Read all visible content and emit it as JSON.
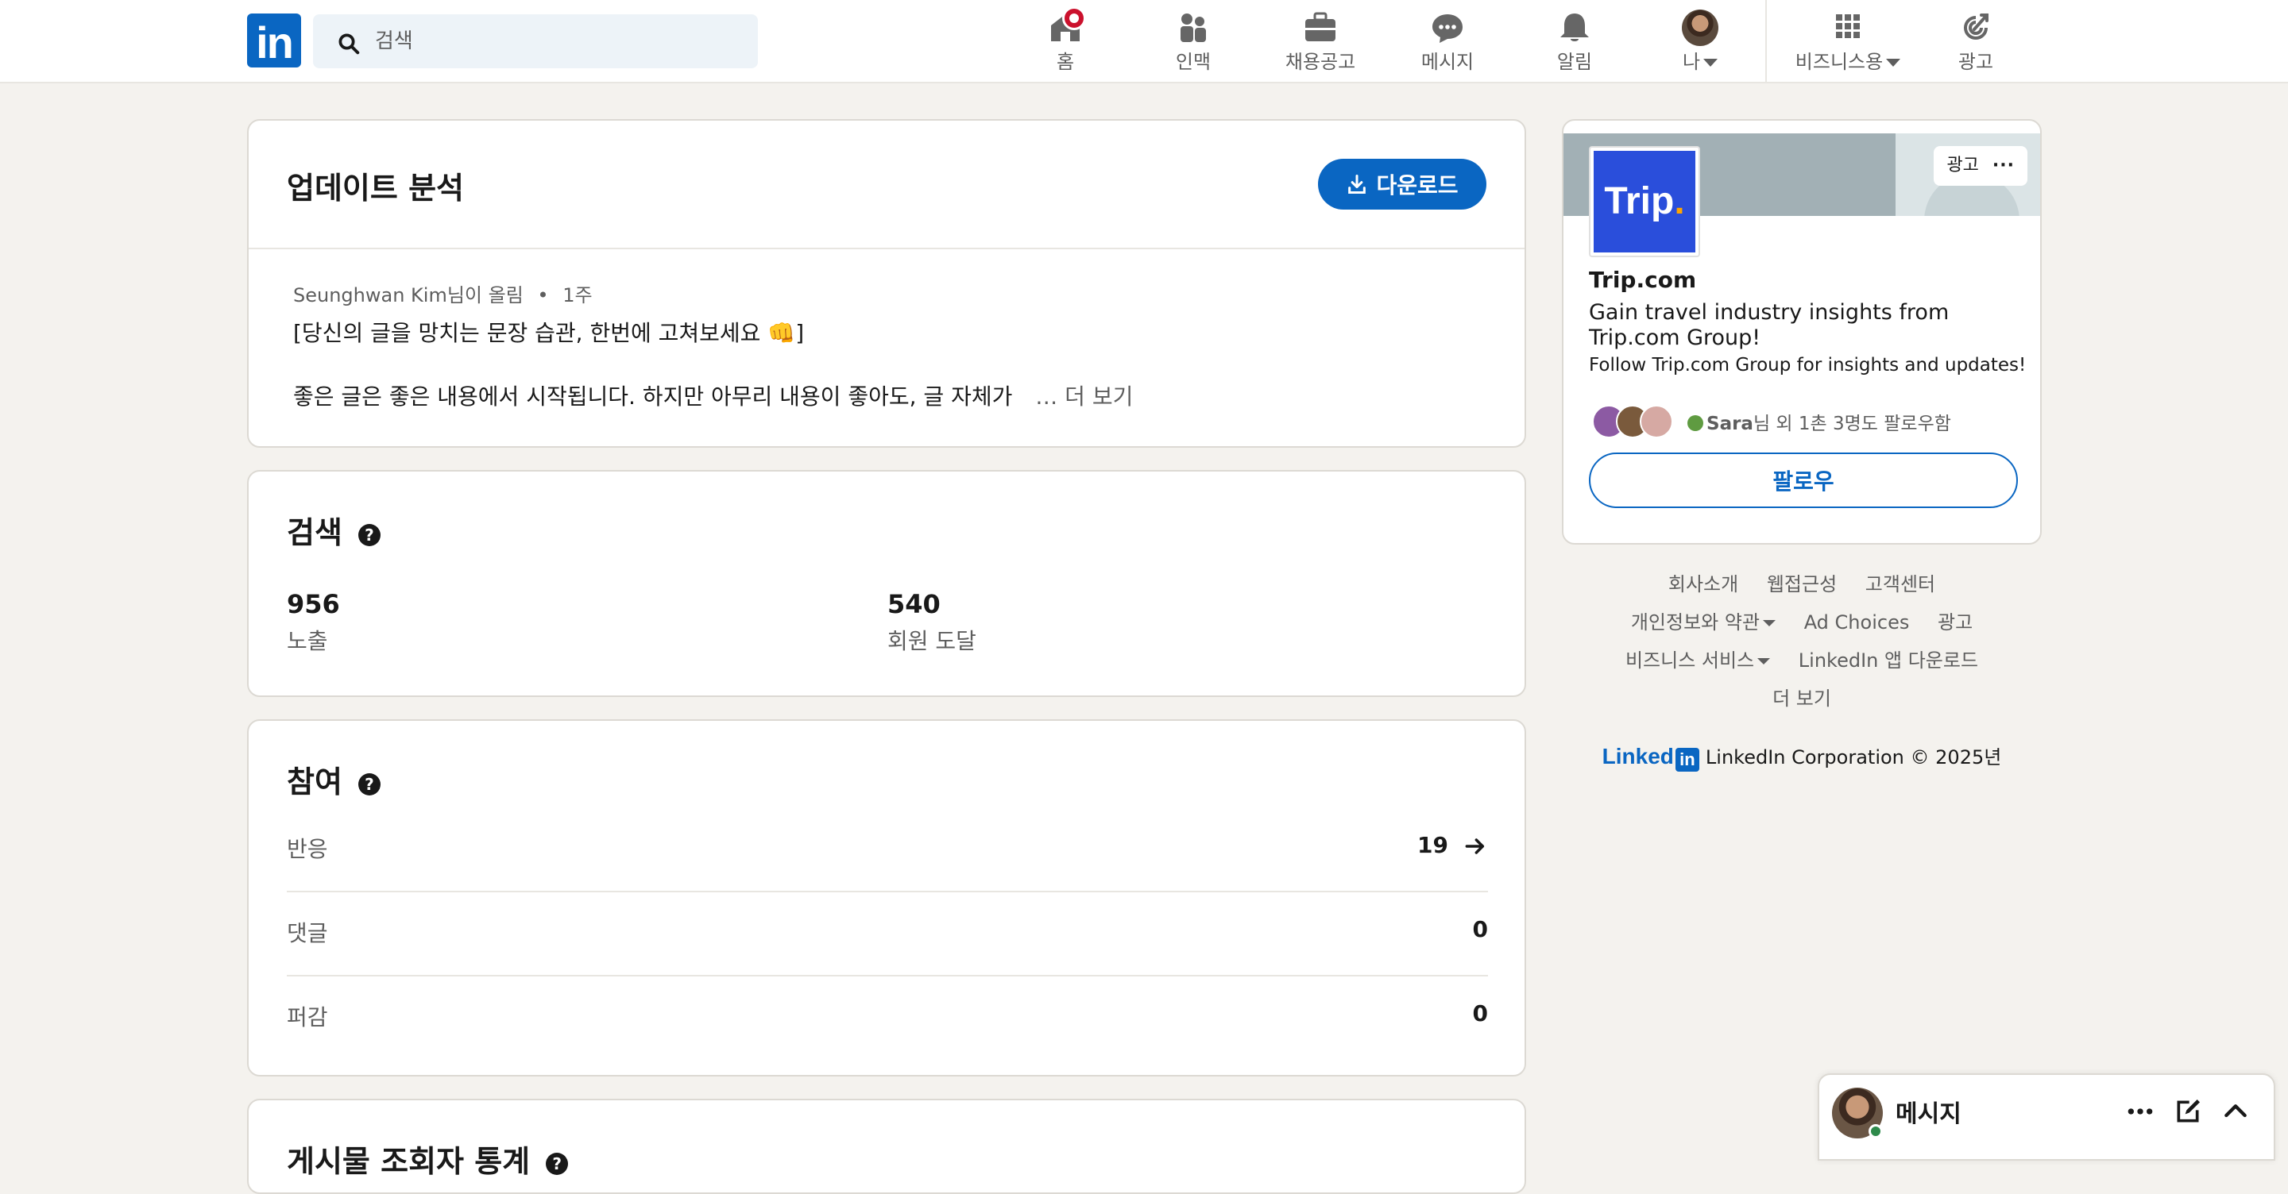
{
  "nav": {
    "logo": "in",
    "search_placeholder": "검색",
    "items": [
      {
        "label": "홈",
        "icon": "home-icon"
      },
      {
        "label": "인맥",
        "icon": "network-icon"
      },
      {
        "label": "채용공고",
        "icon": "jobs-icon"
      },
      {
        "label": "메시지",
        "icon": "messaging-icon"
      },
      {
        "label": "알림",
        "icon": "notifications-icon"
      },
      {
        "label": "나",
        "icon": "avatar"
      },
      {
        "label": "비즈니스용",
        "icon": "grid-icon"
      },
      {
        "label": "광고",
        "icon": "advertise-icon"
      }
    ]
  },
  "update": {
    "title": "업데이트 분석",
    "download_label": "다운로드",
    "author": "Seunghwan Kim",
    "author_suffix": "님이 올림",
    "separator": "•",
    "time": "1주",
    "post_title": "[당신의 글을 망치는 문장 습관, 한번에 고쳐보세요 👊]",
    "post_excerpt": "좋은 글은 좋은 내용에서 시작됩니다. 하지만 아무리 내용이 좋아도, 글 자체가",
    "more": "… 더 보기"
  },
  "search_stats": {
    "title": "검색",
    "impressions_value": "956",
    "impressions_label": "노출",
    "reach_value": "540",
    "reach_label": "회원 도달"
  },
  "engagement": {
    "title": "참여",
    "rows": [
      {
        "label": "반응",
        "value": "19"
      },
      {
        "label": "댓글",
        "value": "0"
      },
      {
        "label": "퍼감",
        "value": "0"
      }
    ]
  },
  "next_section": {
    "title": "게시물 조회자 통계"
  },
  "ad": {
    "tag": "광고",
    "logo_text": "Trip",
    "logo_dot": ".",
    "company": "Trip.com",
    "headline": "Gain travel industry insights from Trip.com Group!",
    "body": "Follow Trip.com Group for insights and updates!",
    "follower_name": "Sara",
    "follower_text": "님 외 1촌 3명도 팔로우함",
    "follow_label": "팔로우"
  },
  "footer": {
    "links_row1": [
      "회사소개",
      "웹접근성",
      "고객센터"
    ],
    "links_row2": [
      "개인정보와 약관",
      "Ad Choices",
      "광고"
    ],
    "links_row3": [
      "비즈니스 서비스",
      "LinkedIn 앱 다운로드"
    ],
    "links_row4": [
      "더 보기"
    ],
    "brand_word": "Linked",
    "brand_box": "in",
    "copyright": "LinkedIn Corporation © 2025년"
  },
  "messaging": {
    "title": "메시지"
  },
  "colors": {
    "brand": "#0a66c2",
    "badge": "#cb112d",
    "background": "#f4f2ee",
    "trip_blue": "#2a4edb"
  }
}
